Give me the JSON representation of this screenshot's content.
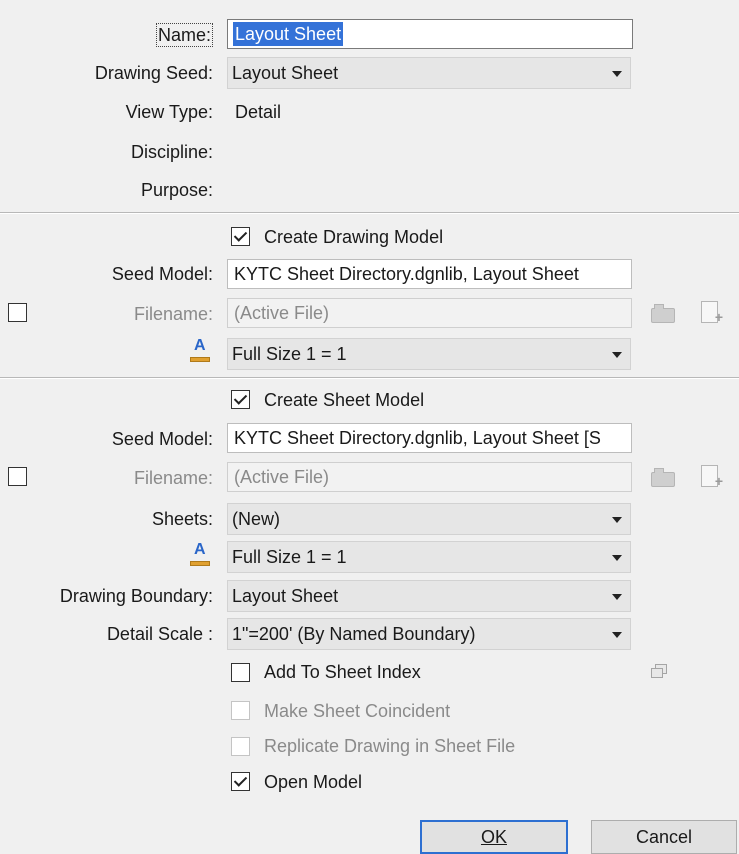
{
  "name": {
    "label": "Name:",
    "value": "Layout Sheet"
  },
  "drawing_seed": {
    "label": "Drawing Seed:",
    "value": "Layout Sheet"
  },
  "view_type": {
    "label": "View Type:",
    "value": "Detail"
  },
  "discipline": {
    "label": "Discipline:"
  },
  "purpose": {
    "label": "Purpose:"
  },
  "drawing_model": {
    "create_label": "Create Drawing Model",
    "create_checked": true,
    "seed_label": "Seed Model:",
    "seed_value": "KYTC Sheet Directory.dgnlib, Layout Sheet",
    "filename_label": "Filename:",
    "filename_value": "(Active File)",
    "filename_checked": false,
    "annotation_scale": "Full Size 1 = 1"
  },
  "sheet_model": {
    "create_label": "Create Sheet Model",
    "create_checked": true,
    "seed_label": "Seed Model:",
    "seed_value": "KYTC Sheet Directory.dgnlib, Layout Sheet [S",
    "filename_label": "Filename:",
    "filename_value": "(Active File)",
    "filename_checked": false,
    "sheets_label": "Sheets:",
    "sheets_value": "(New)",
    "annotation_scale": "Full Size 1 = 1",
    "boundary_label": "Drawing Boundary:",
    "boundary_value": "Layout Sheet",
    "detail_scale_label": "Detail Scale :",
    "detail_scale_value": "1\"=200' (By Named Boundary)"
  },
  "options": {
    "add_to_index": "Add To Sheet Index",
    "make_coincident": "Make Sheet Coincident",
    "replicate": "Replicate Drawing in Sheet File",
    "open_model": "Open Model",
    "add_to_index_checked": false,
    "make_coincident_checked": false,
    "replicate_checked": false,
    "open_model_checked": true
  },
  "buttons": {
    "ok": "OK",
    "cancel": "Cancel"
  },
  "colors": {
    "accent": "#2d6fd1",
    "selection": "#3472d8"
  },
  "icons": [
    "annotation-scale-icon",
    "folder-icon",
    "new-file-icon",
    "sheet-index-icon"
  ]
}
